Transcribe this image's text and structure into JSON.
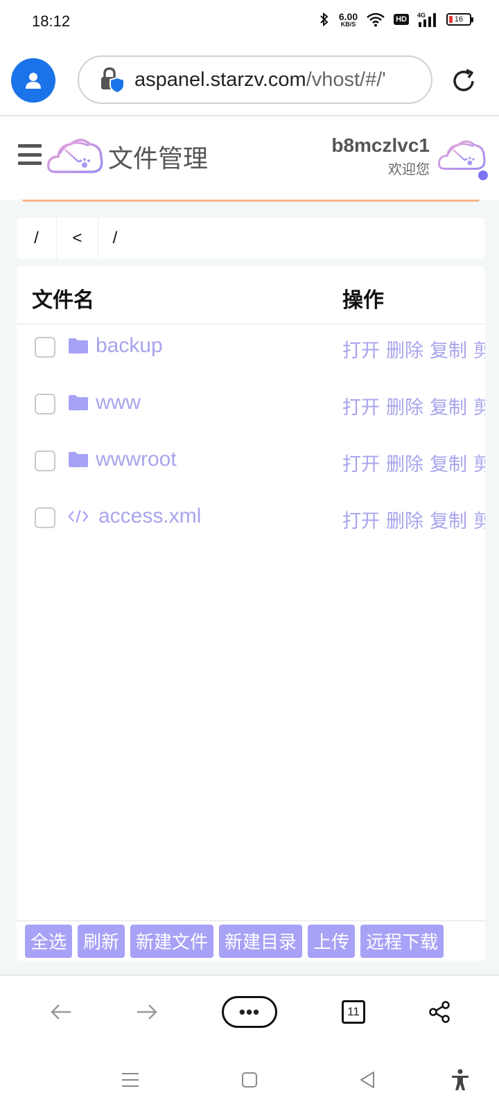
{
  "status_bar": {
    "time": "18:12",
    "net_speed_value": "6.00",
    "net_speed_unit": "KB/S",
    "hd": "HD",
    "network": "4G",
    "battery": "16"
  },
  "browser": {
    "url_host": "aspanel.starzv.com",
    "url_path": "/vhost/#/'"
  },
  "header": {
    "title": "文件管理",
    "username": "b8mczlvc1",
    "welcome": "欢迎您"
  },
  "breadcrumb": {
    "items": [
      "/",
      "<",
      "/"
    ]
  },
  "table": {
    "col_name": "文件名",
    "col_ops": "操作",
    "rows": [
      {
        "name": "backup",
        "type": "folder"
      },
      {
        "name": "www",
        "type": "folder"
      },
      {
        "name": "wwwroot",
        "type": "folder"
      },
      {
        "name": "access.xml",
        "type": "code-file"
      }
    ],
    "ops": [
      "打开",
      "删除",
      "复制",
      "剪"
    ]
  },
  "actions": [
    "全选",
    "刷新",
    "新建文件",
    "新建目录",
    "上传",
    "远程下载"
  ],
  "toolbar": {
    "more": "•••",
    "tab_count": "11"
  },
  "colors": {
    "accent": "#a7a2f6",
    "link": "#a8a4ee",
    "profile": "#1a73e8",
    "underline": "#f4b488"
  }
}
